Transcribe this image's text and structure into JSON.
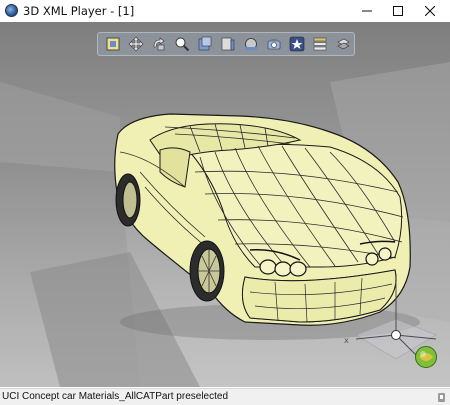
{
  "window": {
    "title": "3D XML Player - [1]"
  },
  "title_controls": {
    "minimize_icon": "minimize-icon",
    "maximize_icon": "maximize-icon",
    "close_icon": "close-icon"
  },
  "toolbar": {
    "tools": [
      "fit-all-icon",
      "pan-icon",
      "rotate-icon",
      "zoom-icon",
      "view-mode-icon",
      "measure-icon",
      "section-icon",
      "camera-icon",
      "favorite-view-icon",
      "layers-icon",
      "explode-icon"
    ]
  },
  "statusbar": {
    "message": "UCI Concept car Materials_AllCATPart preselected"
  },
  "colors": {
    "car_body": "#f0f0b4",
    "background_top": "#7e7e7e",
    "background_bottom": "#c4c4c4",
    "toolbar": "#9aa2b0"
  }
}
